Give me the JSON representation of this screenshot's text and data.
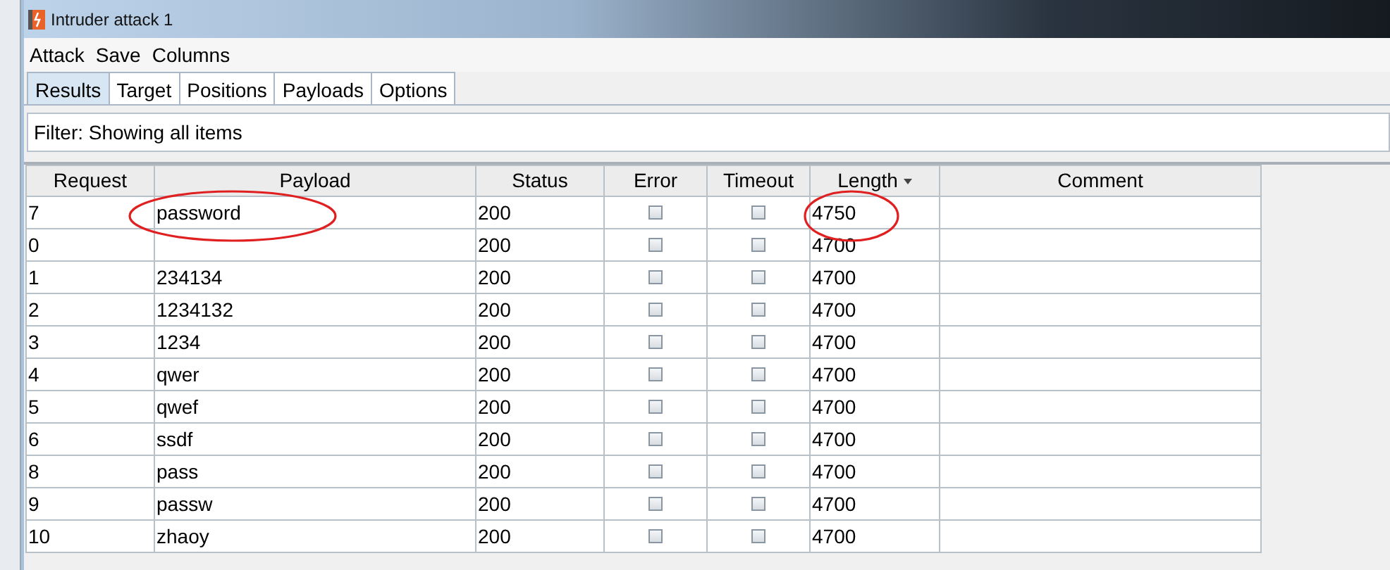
{
  "window": {
    "title": "Intruder attack 1"
  },
  "menu": [
    "Attack",
    "Save",
    "Columns"
  ],
  "tabs": [
    {
      "label": "Results",
      "selected": true
    },
    {
      "label": "Target",
      "selected": false
    },
    {
      "label": "Positions",
      "selected": false
    },
    {
      "label": "Payloads",
      "selected": false
    },
    {
      "label": "Options",
      "selected": false
    }
  ],
  "filter": "Filter: Showing all items",
  "table": {
    "columns": [
      {
        "label": "Request",
        "sorted": false
      },
      {
        "label": "Payload",
        "sorted": false
      },
      {
        "label": "Status",
        "sorted": false
      },
      {
        "label": "Error",
        "sorted": false
      },
      {
        "label": "Timeout",
        "sorted": false
      },
      {
        "label": "Length",
        "sorted": true
      },
      {
        "label": "Comment",
        "sorted": false
      }
    ],
    "rows": [
      {
        "request": "7",
        "payload": "password",
        "status": "200",
        "error": false,
        "timeout": false,
        "length": "4750",
        "payload_circled": true,
        "length_circled": true
      },
      {
        "request": "0",
        "status": "200",
        "error": false,
        "timeout": false,
        "length": "4700"
      },
      {
        "request": "1",
        "payload": "234134",
        "status": "200",
        "error": false,
        "timeout": false,
        "length": "4700"
      },
      {
        "request": "2",
        "payload": "1234132",
        "status": "200",
        "error": false,
        "timeout": false,
        "length": "4700"
      },
      {
        "request": "3",
        "payload": "1234",
        "status": "200",
        "error": false,
        "timeout": false,
        "length": "4700"
      },
      {
        "request": "4",
        "payload": "qwer",
        "status": "200",
        "error": false,
        "timeout": false,
        "length": "4700"
      },
      {
        "request": "5",
        "payload": "qwef",
        "status": "200",
        "error": false,
        "timeout": false,
        "length": "4700"
      },
      {
        "request": "6",
        "payload": "ssdf",
        "status": "200",
        "error": false,
        "timeout": false,
        "length": "4700"
      },
      {
        "request": "8",
        "payload": "pass",
        "status": "200",
        "error": false,
        "timeout": false,
        "length": "4700"
      },
      {
        "request": "9",
        "payload": "passw",
        "status": "200",
        "error": false,
        "timeout": false,
        "length": "4700"
      },
      {
        "request": "10",
        "payload": "zhaoy",
        "status": "200",
        "error": false,
        "timeout": false,
        "length": "4700"
      }
    ]
  }
}
